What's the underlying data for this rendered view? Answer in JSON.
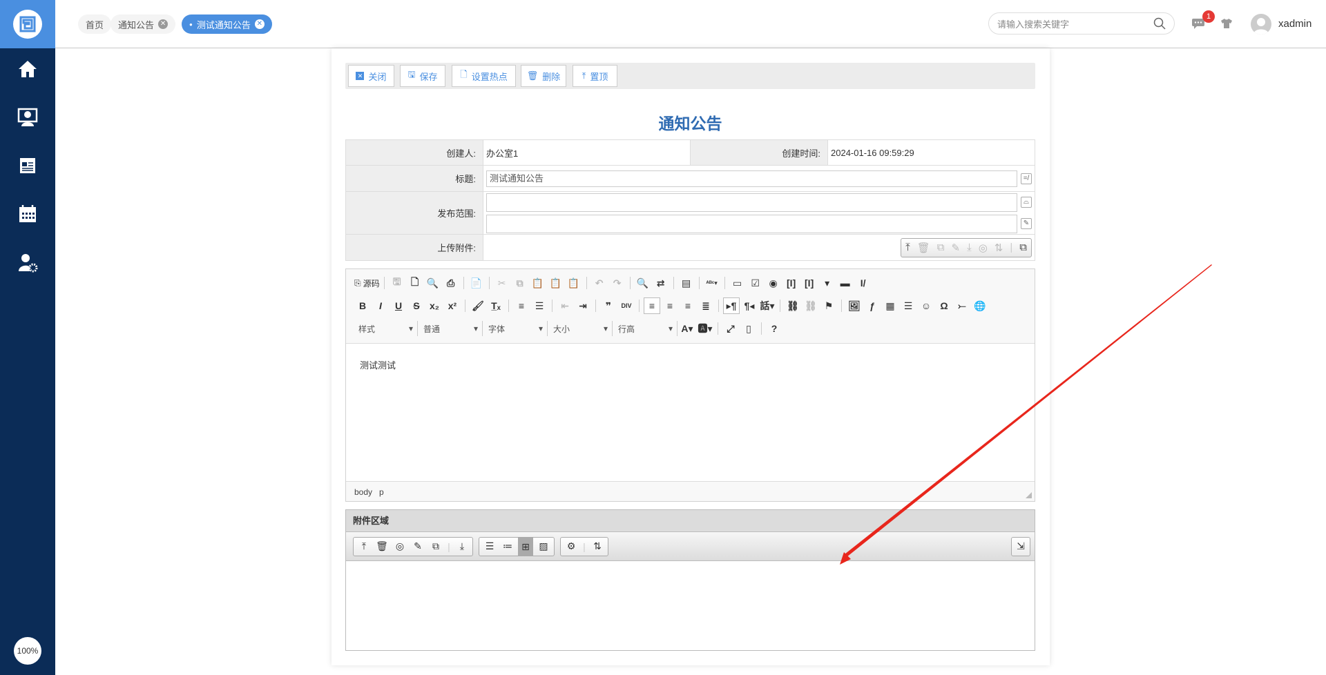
{
  "sidebar": {
    "items": [
      {
        "icon": "home-icon"
      },
      {
        "icon": "desktop-user-icon"
      },
      {
        "icon": "newspaper-icon"
      },
      {
        "icon": "calendar-icon"
      },
      {
        "icon": "user-settings-icon"
      }
    ],
    "zoom": "100%"
  },
  "header": {
    "tabs": [
      {
        "label": "首页",
        "closable": false
      },
      {
        "label": "通知公告",
        "closable": true
      },
      {
        "label": "测试通知公告",
        "closable": true,
        "active": true
      }
    ],
    "search_placeholder": "请输入搜索关键字",
    "badge": "1",
    "username": "xadmin"
  },
  "toolbar": {
    "buttons": [
      {
        "label": "关闭",
        "icon": "close-icon"
      },
      {
        "label": "保存",
        "icon": "save-icon"
      },
      {
        "label": "设置热点",
        "icon": "hotspot-icon"
      },
      {
        "label": "删除",
        "icon": "trash-icon"
      },
      {
        "label": "置顶",
        "icon": "pin-top-icon"
      }
    ]
  },
  "form": {
    "title": "通知公告",
    "creator_label": "创建人:",
    "creator": "办公室1",
    "created_label": "创建时间:",
    "created": "2024-01-16 09:59:29",
    "subject_label": "标题:",
    "subject": "测试通知公告",
    "scope_label": "发布范围:",
    "upload_label": "上传附件:"
  },
  "editor": {
    "source_label": "源码",
    "dropdowns": [
      "样式",
      "普通",
      "字体",
      "大小",
      "行高"
    ],
    "content": "测试测试",
    "path": [
      "body",
      "p"
    ]
  },
  "attachments": {
    "title": "附件区域"
  },
  "colors": {
    "accent": "#4a8fe0",
    "sidebar": "#0b2c57",
    "title": "#2f6bb2",
    "annotation": "#e8261c"
  }
}
